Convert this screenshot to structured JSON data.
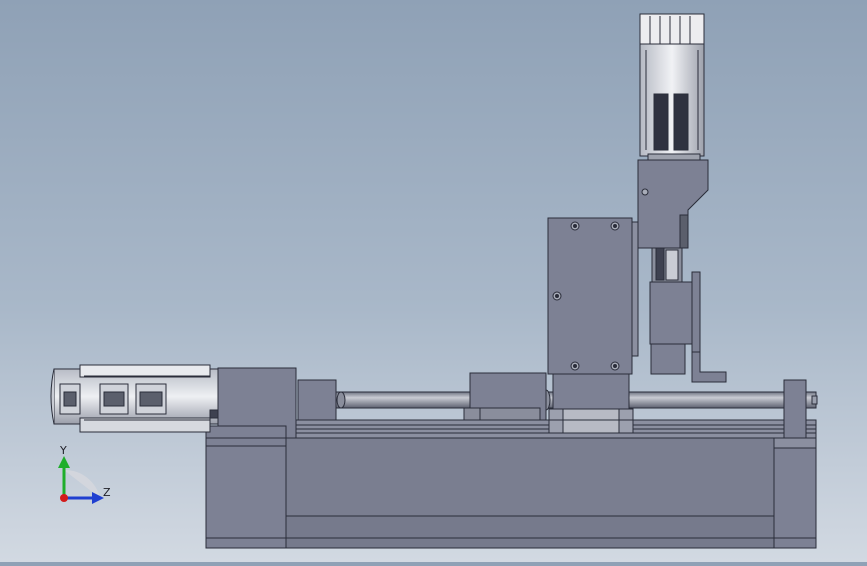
{
  "view": {
    "background_top": "#8fa1b6",
    "background_bottom": "#d2d9e2",
    "part_color": "#7d8194",
    "edge_color": "#2a2d3a",
    "shaft_color": "#9ba0ad"
  },
  "triad": {
    "y_label": "Y",
    "z_label": "Z",
    "y_color": "#1fae2b",
    "z_color": "#1f3fd0",
    "x_color": "#d21b1b"
  },
  "components": [
    "base-frame",
    "linear-rail",
    "ball-screw",
    "x-motor",
    "carriage",
    "vertical-plate",
    "z-motor",
    "z-slide",
    "end-support"
  ]
}
